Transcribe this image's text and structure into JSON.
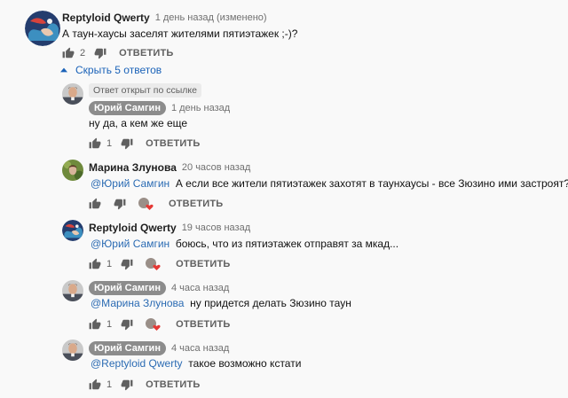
{
  "top_comment": {
    "author": "Reptyloid Qwerty",
    "time": "1 день назад (изменено)",
    "text": "А таун-хаусы заселят жителями пятиэтажек ;-)?",
    "likes": "2",
    "reply_label": "ОТВЕТИТЬ"
  },
  "replies_toggle": {
    "label": "Скрыть 5 ответов"
  },
  "replies": [
    {
      "badge": "Ответ открыт по ссылке",
      "author": "Юрий Самгин",
      "time": "1 день назад",
      "text": "ну да, а кем же еще",
      "likes": "1",
      "reply_label": "ОТВЕТИТЬ"
    },
    {
      "author": "Марина Злунова",
      "time": "20 часов назад",
      "mention": "@Юрий Самгин",
      "text": "А если все  жители пятиэтажек  захотят в таунхаусы  - все Зюзино ими застроят?",
      "reply_label": "ОТВЕТИТЬ"
    },
    {
      "author": "Reptyloid Qwerty",
      "time": "19 часов назад",
      "mention": "@Юрий Самгин",
      "text": "боюсь, что из пятиэтажек отправят за мкад...",
      "likes": "1",
      "reply_label": "ОТВЕТИТЬ"
    },
    {
      "author": "Юрий Самгин",
      "time": "4 часа назад",
      "mention": "@Марина Злунова",
      "text": "ну придется делать Зюзино таун",
      "likes": "1",
      "reply_label": "ОТВЕТИТЬ"
    },
    {
      "author": "Юрий Самгин",
      "time": "4 часа назад",
      "mention": "@Reptyloid Qwerty",
      "text": "такое возможно кстати",
      "likes": "1",
      "reply_label": "ОТВЕТИТЬ"
    }
  ],
  "colors": {
    "link": "#2b6bb3",
    "pill": "#8c8c8c",
    "heart": "#e53935",
    "background": "#f9f9f9"
  }
}
